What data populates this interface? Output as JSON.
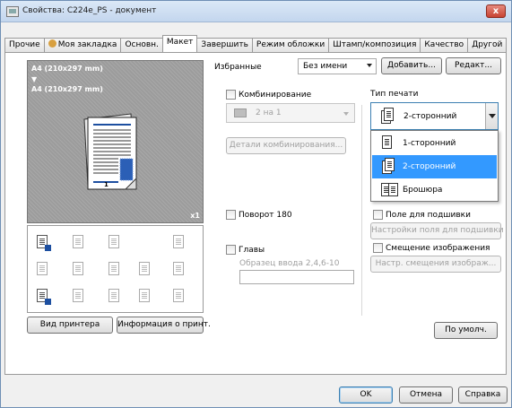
{
  "window": {
    "title": "Свойства: C224e_PS - документ",
    "close_glyph": "x"
  },
  "tabs": [
    {
      "label": "Прочие",
      "active": false
    },
    {
      "label": "Моя закладка",
      "active": false,
      "icon": "person-icon"
    },
    {
      "label": "Основн.",
      "active": false
    },
    {
      "label": "Макет",
      "active": true
    },
    {
      "label": "Завершить",
      "active": false
    },
    {
      "label": "Режим обложки",
      "active": false
    },
    {
      "label": "Штамп/композиция",
      "active": false
    },
    {
      "label": "Качество",
      "active": false
    },
    {
      "label": "Другой",
      "active": false
    }
  ],
  "preview": {
    "paper_top": "A4 (210x297 mm)",
    "arrow": "▼",
    "paper_bottom": "A4 (210x297 mm)",
    "copies": "x1",
    "page_number": "1"
  },
  "left_buttons": {
    "printer_view": "Вид принтера",
    "printer_info": "Информация о принт."
  },
  "favorites": {
    "label": "Избранные",
    "value": "Без имени",
    "add": "Добавить...",
    "edit": "Редакт..."
  },
  "combine": {
    "checkbox_label": "Комбинирование",
    "value": "2 на 1",
    "details_button": "Детали комбинирования..."
  },
  "rotate": {
    "label": "Поворот 180"
  },
  "chapters": {
    "label": "Главы",
    "hint": "Образец ввода 2,4,6-10",
    "value": ""
  },
  "print_type": {
    "label": "Тип печати",
    "selected": "2-сторонний",
    "options": [
      "1-сторонний",
      "2-сторонний",
      "Брошюра"
    ]
  },
  "binding": {
    "label": "Поле для подшивки",
    "settings_button": "Настройки поля для подшивки"
  },
  "image_shift": {
    "label": "Смещение изображения",
    "settings_button": "Настр. смещения изображ..."
  },
  "defaults_button": "По умолч.",
  "footer": {
    "ok": "OK",
    "cancel": "Отмена",
    "help": "Справка"
  },
  "colors": {
    "accent": "#3399ff",
    "page_accent": "#1d4fa0",
    "preview_bg": "#9c9c9c"
  }
}
